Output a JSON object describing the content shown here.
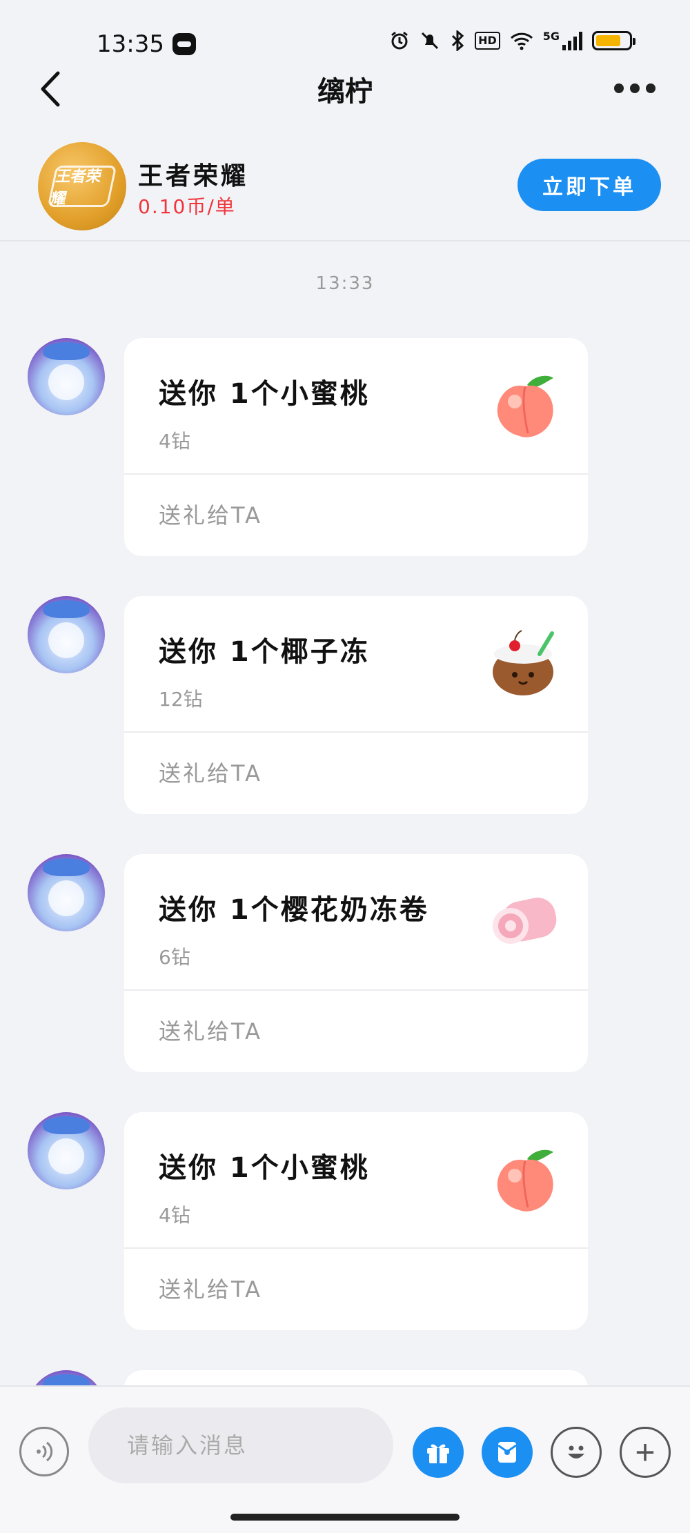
{
  "status_bar": {
    "time": "13:35",
    "network": "5G",
    "hd": "HD",
    "battery_level": 0.75,
    "battery_color": "#f5b400"
  },
  "nav": {
    "title": "缡柠",
    "back_icon": "chevron-left-icon",
    "more_icon": "more-dots-icon"
  },
  "game": {
    "logo_text": "王者荣耀",
    "name": "王者荣耀",
    "price": "0.10币/单",
    "order_button": "立即下单",
    "price_color": "#f0353b",
    "accent_color": "#1b8ff2"
  },
  "chat": {
    "timestamp": "13:33",
    "messages": [
      {
        "title": "送你 1个小蜜桃",
        "cost": "4钻",
        "action": "送礼给TA",
        "gift_icon": "peach-icon"
      },
      {
        "title": "送你 1个椰子冻",
        "cost": "12钻",
        "action": "送礼给TA",
        "gift_icon": "coconut-icon"
      },
      {
        "title": "送你 1个樱花奶冻卷",
        "cost": "6钻",
        "action": "送礼给TA",
        "gift_icon": "sakura-roll-icon"
      },
      {
        "title": "送你 1个小蜜桃",
        "cost": "4钻",
        "action": "送礼给TA",
        "gift_icon": "peach-icon"
      }
    ]
  },
  "input_bar": {
    "placeholder": "请输入消息",
    "plus_label": "+",
    "icons": [
      "voice-icon",
      "gift-icon",
      "red-packet-icon",
      "emoji-icon",
      "plus-icon"
    ]
  }
}
